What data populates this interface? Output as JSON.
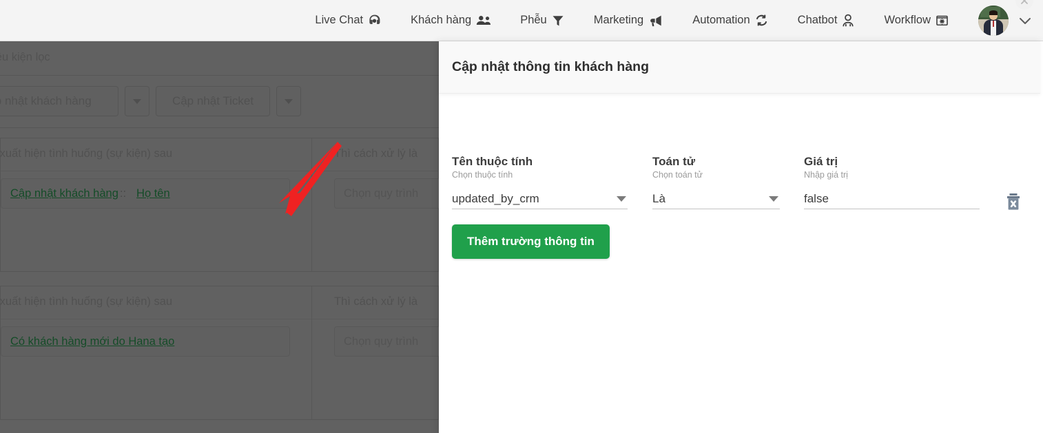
{
  "topnav": {
    "items": [
      {
        "label": "Live Chat",
        "icon": "headset-icon",
        "name": "nav-live-chat"
      },
      {
        "label": "Khách hàng",
        "icon": "users-icon",
        "name": "nav-khach-hang"
      },
      {
        "label": "Phễu",
        "icon": "funnel-icon",
        "name": "nav-pheu"
      },
      {
        "label": "Marketing",
        "icon": "megaphone-icon",
        "name": "nav-marketing"
      },
      {
        "label": "Automation",
        "icon": "refresh-icon",
        "name": "nav-automation"
      },
      {
        "label": "Chatbot",
        "icon": "robot-icon",
        "name": "nav-chatbot"
      },
      {
        "label": "Workflow",
        "icon": "workflow-gear-icon",
        "name": "nav-workflow"
      }
    ],
    "avatar_alt": "avatar",
    "caret_icon": "chevron-down-icon",
    "close_icon": "close-icon",
    "bg": "#f4f4f4"
  },
  "background": {
    "filter_bar_text": "on điều kiện lọc",
    "buttons": {
      "update_customer": "ập nhật khách hàng",
      "update_ticket": "Cập nhật Ticket",
      "caret_icon": "caret-down-icon"
    },
    "cards": [
      {
        "header_left": "lếu xuất hiện tình huống (sự kiện) sau",
        "header_right": "Thì cách xử lý là",
        "trigger_primary": "Cập nhật khách hàng",
        "trigger_separator": "::",
        "trigger_secondary": "Họ tên",
        "process_placeholder": "Chọn quy trình"
      },
      {
        "header_left": "lếu xuất hiện tình huống (sự kiện) sau",
        "header_right": "Thì cách xử lý là",
        "trigger_primary": "Có khách hàng mới do Hana tạo",
        "trigger_separator": "",
        "trigger_secondary": "",
        "process_placeholder": "Chọn quy trình"
      }
    ],
    "link_color": "#38c76b",
    "overlay_color": "rgba(0,0,0,0.62)"
  },
  "annotation": {
    "type": "arrow",
    "color": "#ef2222",
    "from": "490,208",
    "to": "414,306"
  },
  "panel": {
    "title": "Cập nhật thông tin khách hàng",
    "fields": [
      {
        "label": "Tên thuộc tính",
        "sublabel": "Chọn thuộc tính",
        "value": "updated_by_crm",
        "control": "select",
        "icon": "caret-down-icon"
      },
      {
        "label": "Toán tử",
        "sublabel": "Chọn toán tử",
        "value": "Là",
        "control": "select",
        "icon": "caret-down-icon"
      },
      {
        "label": "Giá trị",
        "sublabel": "Nhập giá trị",
        "value": "false",
        "control": "text",
        "icon": ""
      }
    ],
    "delete_icon": "trash-x-icon",
    "add_field_label": "Thêm trường thông tin",
    "add_field_color": "#20a04b"
  }
}
